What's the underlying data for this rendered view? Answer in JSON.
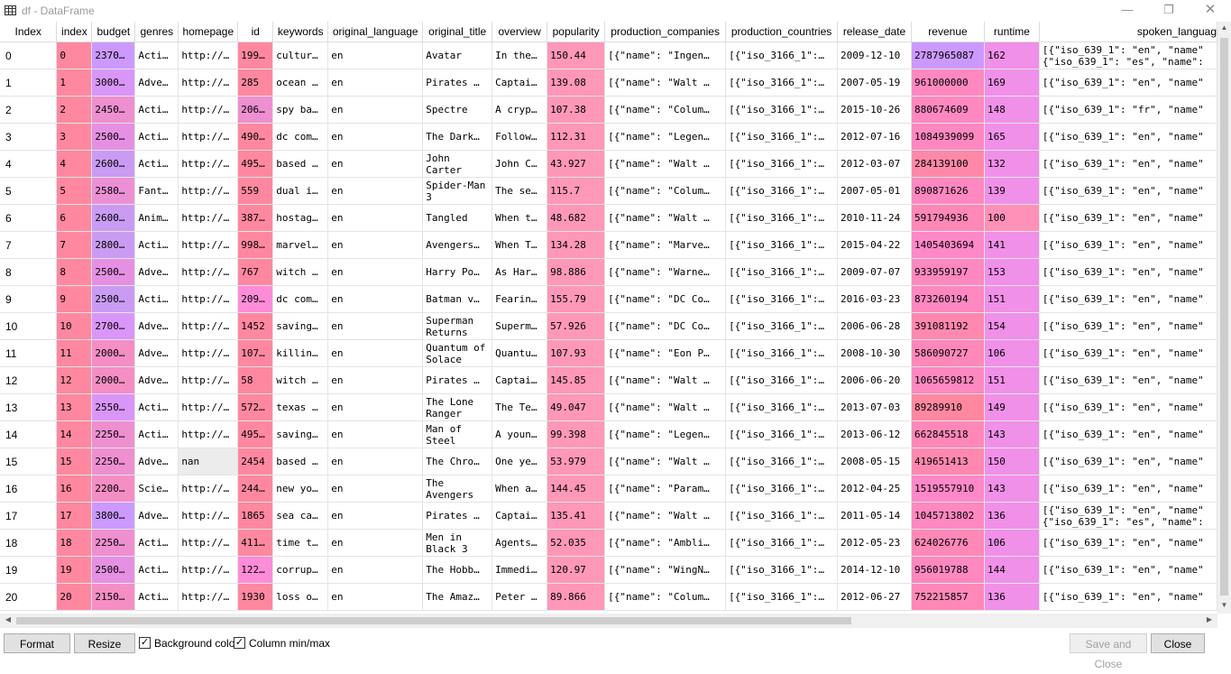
{
  "window": {
    "title": "df - DataFrame",
    "minimize": "—",
    "maximize": "❐",
    "close": "✕"
  },
  "columns": [
    "Index",
    "index",
    "budget",
    "genres",
    "homepage",
    "id",
    "keywords",
    "original_language",
    "original_title",
    "overview",
    "popularity",
    "production_companies",
    "production_countries",
    "release_date",
    "revenue",
    "runtime",
    "spoken_languag"
  ],
  "rows": [
    {
      "Index": "0",
      "index": "0",
      "budget": "2370…",
      "genres": "Acti…",
      "homepage": "http://…",
      "id": "199…",
      "keywords": "cultur…",
      "lang": "en",
      "title": "Avatar",
      "overview": "In the…",
      "popularity": "150.44",
      "companies": "[{\"name\": \"Ingen…",
      "countries": "[{\"iso_3166_1\":…",
      "release": "2009-12-10",
      "revenue": "2787965087",
      "runtime": "162",
      "spoken": "[{\"iso_639_1\": \"en\", \"name\"\n{\"iso_639_1\": \"es\", \"name\":"
    },
    {
      "Index": "1",
      "index": "1",
      "budget": "3000…",
      "genres": "Adve…",
      "homepage": "http://…",
      "id": "285",
      "keywords": "ocean …",
      "lang": "en",
      "title": "Pirates …",
      "overview": "Captai…",
      "popularity": "139.08",
      "companies": "[{\"name\": \"Walt …",
      "countries": "[{\"iso_3166_1\":…",
      "release": "2007-05-19",
      "revenue": "961000000",
      "runtime": "169",
      "spoken": "[{\"iso_639_1\": \"en\", \"name\""
    },
    {
      "Index": "2",
      "index": "2",
      "budget": "2450…",
      "genres": "Acti…",
      "homepage": "http://…",
      "id": "206…",
      "keywords": "spy ba…",
      "lang": "en",
      "title": "Spectre",
      "overview": "A cryp…",
      "popularity": "107.38",
      "companies": "[{\"name\": \"Colum…",
      "countries": "[{\"iso_3166_1\":…",
      "release": "2015-10-26",
      "revenue": "880674609",
      "runtime": "148",
      "spoken": "[{\"iso_639_1\": \"fr\", \"name\""
    },
    {
      "Index": "3",
      "index": "3",
      "budget": "2500…",
      "genres": "Acti…",
      "homepage": "http://…",
      "id": "490…",
      "keywords": "dc com…",
      "lang": "en",
      "title": "The Dark…",
      "overview": "Follow…",
      "popularity": "112.31",
      "companies": "[{\"name\": \"Legen…",
      "countries": "[{\"iso_3166_1\":…",
      "release": "2012-07-16",
      "revenue": "1084939099",
      "runtime": "165",
      "spoken": "[{\"iso_639_1\": \"en\", \"name\""
    },
    {
      "Index": "4",
      "index": "4",
      "budget": "2600…",
      "genres": "Acti…",
      "homepage": "http://…",
      "id": "495…",
      "keywords": "based …",
      "lang": "en",
      "title": "John Carter",
      "overview": "John C…",
      "popularity": "43.927",
      "companies": "[{\"name\": \"Walt …",
      "countries": "[{\"iso_3166_1\":…",
      "release": "2012-03-07",
      "revenue": "284139100",
      "runtime": "132",
      "spoken": "[{\"iso_639_1\": \"en\", \"name\""
    },
    {
      "Index": "5",
      "index": "5",
      "budget": "2580…",
      "genres": "Fant…",
      "homepage": "http://…",
      "id": "559",
      "keywords": "dual i…",
      "lang": "en",
      "title": "Spider-Man 3",
      "overview": "The se…",
      "popularity": "115.7",
      "companies": "[{\"name\": \"Colum…",
      "countries": "[{\"iso_3166_1\":…",
      "release": "2007-05-01",
      "revenue": "890871626",
      "runtime": "139",
      "spoken": "[{\"iso_639_1\": \"en\", \"name\""
    },
    {
      "Index": "6",
      "index": "6",
      "budget": "2600…",
      "genres": "Anim…",
      "homepage": "http://…",
      "id": "387…",
      "keywords": "hostag…",
      "lang": "en",
      "title": "Tangled",
      "overview": "When t…",
      "popularity": "48.682",
      "companies": "[{\"name\": \"Walt …",
      "countries": "[{\"iso_3166_1\":…",
      "release": "2010-11-24",
      "revenue": "591794936",
      "runtime": "100",
      "spoken": "[{\"iso_639_1\": \"en\", \"name\""
    },
    {
      "Index": "7",
      "index": "7",
      "budget": "2800…",
      "genres": "Acti…",
      "homepage": "http://…",
      "id": "998…",
      "keywords": "marvel…",
      "lang": "en",
      "title": "Avengers…",
      "overview": "When T…",
      "popularity": "134.28",
      "companies": "[{\"name\": \"Marve…",
      "countries": "[{\"iso_3166_1\":…",
      "release": "2015-04-22",
      "revenue": "1405403694",
      "runtime": "141",
      "spoken": "[{\"iso_639_1\": \"en\", \"name\""
    },
    {
      "Index": "8",
      "index": "8",
      "budget": "2500…",
      "genres": "Adve…",
      "homepage": "http://…",
      "id": "767",
      "keywords": "witch …",
      "lang": "en",
      "title": "Harry Po…",
      "overview": "As Har…",
      "popularity": "98.886",
      "companies": "[{\"name\": \"Warne…",
      "countries": "[{\"iso_3166_1\":…",
      "release": "2009-07-07",
      "revenue": "933959197",
      "runtime": "153",
      "spoken": "[{\"iso_639_1\": \"en\", \"name\""
    },
    {
      "Index": "9",
      "index": "9",
      "budget": "2500…",
      "genres": "Acti…",
      "homepage": "http://…",
      "id": "209…",
      "keywords": "dc com…",
      "lang": "en",
      "title": "Batman v…",
      "overview": "Fearin…",
      "popularity": "155.79",
      "companies": "[{\"name\": \"DC Co…",
      "countries": "[{\"iso_3166_1\":…",
      "release": "2016-03-23",
      "revenue": "873260194",
      "runtime": "151",
      "spoken": "[{\"iso_639_1\": \"en\", \"name\""
    },
    {
      "Index": "10",
      "index": "10",
      "budget": "2700…",
      "genres": "Adve…",
      "homepage": "http://…",
      "id": "1452",
      "keywords": "saving…",
      "lang": "en",
      "title": "Superman Returns",
      "overview": "Superm…",
      "popularity": "57.926",
      "companies": "[{\"name\": \"DC Co…",
      "countries": "[{\"iso_3166_1\":…",
      "release": "2006-06-28",
      "revenue": "391081192",
      "runtime": "154",
      "spoken": "[{\"iso_639_1\": \"en\", \"name\""
    },
    {
      "Index": "11",
      "index": "11",
      "budget": "2000…",
      "genres": "Adve…",
      "homepage": "http://…",
      "id": "107…",
      "keywords": "killin…",
      "lang": "en",
      "title": "Quantum of Solace",
      "overview": "Quantu…",
      "popularity": "107.93",
      "companies": "[{\"name\": \"Eon P…",
      "countries": "[{\"iso_3166_1\":…",
      "release": "2008-10-30",
      "revenue": "586090727",
      "runtime": "106",
      "spoken": "[{\"iso_639_1\": \"en\", \"name\""
    },
    {
      "Index": "12",
      "index": "12",
      "budget": "2000…",
      "genres": "Adve…",
      "homepage": "http://…",
      "id": "58",
      "keywords": "witch …",
      "lang": "en",
      "title": "Pirates …",
      "overview": "Captai…",
      "popularity": "145.85",
      "companies": "[{\"name\": \"Walt …",
      "countries": "[{\"iso_3166_1\":…",
      "release": "2006-06-20",
      "revenue": "1065659812",
      "runtime": "151",
      "spoken": "[{\"iso_639_1\": \"en\", \"name\""
    },
    {
      "Index": "13",
      "index": "13",
      "budget": "2550…",
      "genres": "Acti…",
      "homepage": "http://…",
      "id": "572…",
      "keywords": "texas …",
      "lang": "en",
      "title": "The Lone Ranger",
      "overview": "The Te…",
      "popularity": "49.047",
      "companies": "[{\"name\": \"Walt …",
      "countries": "[{\"iso_3166_1\":…",
      "release": "2013-07-03",
      "revenue": "89289910",
      "runtime": "149",
      "spoken": "[{\"iso_639_1\": \"en\", \"name\""
    },
    {
      "Index": "14",
      "index": "14",
      "budget": "2250…",
      "genres": "Acti…",
      "homepage": "http://…",
      "id": "495…",
      "keywords": "saving…",
      "lang": "en",
      "title": "Man of Steel",
      "overview": "A youn…",
      "popularity": "99.398",
      "companies": "[{\"name\": \"Legen…",
      "countries": "[{\"iso_3166_1\":…",
      "release": "2013-06-12",
      "revenue": "662845518",
      "runtime": "143",
      "spoken": "[{\"iso_639_1\": \"en\", \"name\""
    },
    {
      "Index": "15",
      "index": "15",
      "budget": "2250…",
      "genres": "Adve…",
      "homepage": "nan",
      "id": "2454",
      "keywords": "based …",
      "lang": "en",
      "title": "The Chro…",
      "overview": "One ye…",
      "popularity": "53.979",
      "companies": "[{\"name\": \"Walt …",
      "countries": "[{\"iso_3166_1\":…",
      "release": "2008-05-15",
      "revenue": "419651413",
      "runtime": "150",
      "spoken": "[{\"iso_639_1\": \"en\", \"name\""
    },
    {
      "Index": "16",
      "index": "16",
      "budget": "2200…",
      "genres": "Scie…",
      "homepage": "http://…",
      "id": "244…",
      "keywords": "new yo…",
      "lang": "en",
      "title": "The Avengers",
      "overview": "When a…",
      "popularity": "144.45",
      "companies": "[{\"name\": \"Param…",
      "countries": "[{\"iso_3166_1\":…",
      "release": "2012-04-25",
      "revenue": "1519557910",
      "runtime": "143",
      "spoken": "[{\"iso_639_1\": \"en\", \"name\""
    },
    {
      "Index": "17",
      "index": "17",
      "budget": "3800…",
      "genres": "Adve…",
      "homepage": "http://…",
      "id": "1865",
      "keywords": "sea ca…",
      "lang": "en",
      "title": "Pirates …",
      "overview": "Captai…",
      "popularity": "135.41",
      "companies": "[{\"name\": \"Walt …",
      "countries": "[{\"iso_3166_1\":…",
      "release": "2011-05-14",
      "revenue": "1045713802",
      "runtime": "136",
      "spoken": "[{\"iso_639_1\": \"en\", \"name\"\n{\"iso_639_1\": \"es\", \"name\":"
    },
    {
      "Index": "18",
      "index": "18",
      "budget": "2250…",
      "genres": "Acti…",
      "homepage": "http://…",
      "id": "411…",
      "keywords": "time t…",
      "lang": "en",
      "title": "Men in Black 3",
      "overview": "Agents…",
      "popularity": "52.035",
      "companies": "[{\"name\": \"Ambli…",
      "countries": "[{\"iso_3166_1\":…",
      "release": "2012-05-23",
      "revenue": "624026776",
      "runtime": "106",
      "spoken": "[{\"iso_639_1\": \"en\", \"name\""
    },
    {
      "Index": "19",
      "index": "19",
      "budget": "2500…",
      "genres": "Acti…",
      "homepage": "http://…",
      "id": "122…",
      "keywords": "corrup…",
      "lang": "en",
      "title": "The Hobb…",
      "overview": "Immedi…",
      "popularity": "120.97",
      "companies": "[{\"name\": \"WingN…",
      "countries": "[{\"iso_3166_1\":…",
      "release": "2014-12-10",
      "revenue": "956019788",
      "runtime": "144",
      "spoken": "[{\"iso_639_1\": \"en\", \"name\""
    },
    {
      "Index": "20",
      "index": "20",
      "budget": "2150…",
      "genres": "Acti…",
      "homepage": "http://…",
      "id": "1930",
      "keywords": "loss o…",
      "lang": "en",
      "title": "The Amaz…",
      "overview": "Peter …",
      "popularity": "89.866",
      "companies": "[{\"name\": \"Colum…",
      "countries": "[{\"iso_3166_1\":…",
      "release": "2012-06-27",
      "revenue": "752215857",
      "runtime": "136",
      "spoken": "[{\"iso_639_1\": \"en\", \"name\""
    }
  ],
  "colors": {
    "index": [
      "#ff88a0",
      "#ff88a0",
      "#ff88a0",
      "#ff88a0",
      "#ff88a0",
      "#ff88a0",
      "#ff88a0",
      "#ff88a0",
      "#ff88a0",
      "#ff88a0",
      "#ff88a0",
      "#ff88a0",
      "#ff88a0",
      "#ff88a0",
      "#ff88a0",
      "#ff88a0",
      "#ff88a0",
      "#ff88a0",
      "#ff88a0",
      "#ff88a0",
      "#ff88a0"
    ],
    "budget": [
      "#cc99ff",
      "#d996f8",
      "#ee8fd0",
      "#e590e2",
      "#c99bf2",
      "#ec90d5",
      "#c99bf2",
      "#c99bf2",
      "#e590e2",
      "#c99bf2",
      "#d996f8",
      "#f48ec5",
      "#f48ec5",
      "#d996f8",
      "#ee8fd0",
      "#ee8fd0",
      "#f48ec5",
      "#cc99ff",
      "#ee8fd0",
      "#e590e2",
      "#f48ec5"
    ],
    "id": [
      "#ff88a0",
      "#ff88a0",
      "#ee8fd0",
      "#ff88a0",
      "#ff88a0",
      "#ff88a0",
      "#ff88a0",
      "#ff88a0",
      "#ff88a0",
      "#ff8cd8",
      "#ff88a0",
      "#ff88a0",
      "#ff88a0",
      "#ff88a0",
      "#ff88a0",
      "#ff88a0",
      "#ff88a0",
      "#ff88a0",
      "#ff88a0",
      "#ff8cd8",
      "#ff88a0"
    ],
    "popularity": [
      "#ff98b8",
      "#ff98b8",
      "#ff98b8",
      "#ff98b8",
      "#ff98b8",
      "#ff98b8",
      "#ff98b8",
      "#ff98b8",
      "#ff98b8",
      "#ff98b8",
      "#ff98b8",
      "#ff98b8",
      "#ff98b8",
      "#ff98b8",
      "#ff98b8",
      "#ff98b8",
      "#ff98b8",
      "#ff98b8",
      "#ff98b8",
      "#ff98b8",
      "#ff98b8"
    ],
    "revenue": [
      "#cc99ff",
      "#ff88c0",
      "#ff88c0",
      "#ff88c0",
      "#ff88a8",
      "#ff88c0",
      "#ff88b8",
      "#ff88c8",
      "#ff88c0",
      "#ff88c0",
      "#ff88b0",
      "#ff88b8",
      "#ff88c0",
      "#ff88a0",
      "#ff88b8",
      "#ff88b0",
      "#ff88c8",
      "#ff88c0",
      "#ff88b8",
      "#ff88c0",
      "#ff88b8"
    ],
    "runtime": [
      "#f090e8",
      "#f090e8",
      "#f090e8",
      "#f090e8",
      "#f090e8",
      "#f090e8",
      "#ff90b8",
      "#f090e8",
      "#f090e8",
      "#f090e8",
      "#f090e8",
      "#f090e8",
      "#f090e8",
      "#f090e8",
      "#f090e8",
      "#f090e8",
      "#f090e8",
      "#f090e8",
      "#f090e8",
      "#f090e8",
      "#f090e8"
    ],
    "header_bg": "#ffffff"
  },
  "buttons": {
    "format": "Format",
    "resize": "Resize",
    "save_close": "Save and Close",
    "close": "Close"
  },
  "checkboxes": {
    "background_color": {
      "label": "Background color",
      "checked": true
    },
    "column_minmax": {
      "label": "Column min/max",
      "checked": true
    }
  }
}
